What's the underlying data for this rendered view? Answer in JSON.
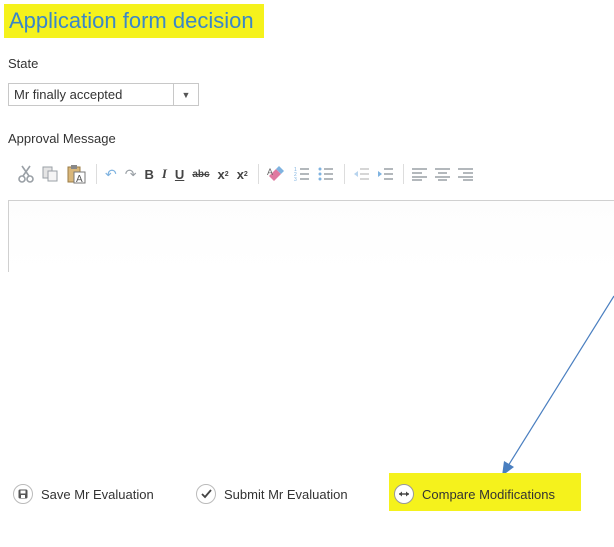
{
  "page": {
    "title": "Application form decision"
  },
  "state": {
    "label": "State",
    "value": "Mr finally accepted"
  },
  "approval": {
    "label": "Approval Message"
  },
  "toolbar": {
    "bold": "B",
    "italic": "I",
    "underline": "U",
    "strike": "abc",
    "subscript": "x",
    "superscript": "x"
  },
  "actions": {
    "save": "Save Mr Evaluation",
    "submit": "Submit Mr Evaluation",
    "compare": "Compare Modifications"
  },
  "colors": {
    "highlight": "#f5f21c",
    "title_text": "#3a87c8",
    "annotation_arrow": "#4a7fc0"
  }
}
